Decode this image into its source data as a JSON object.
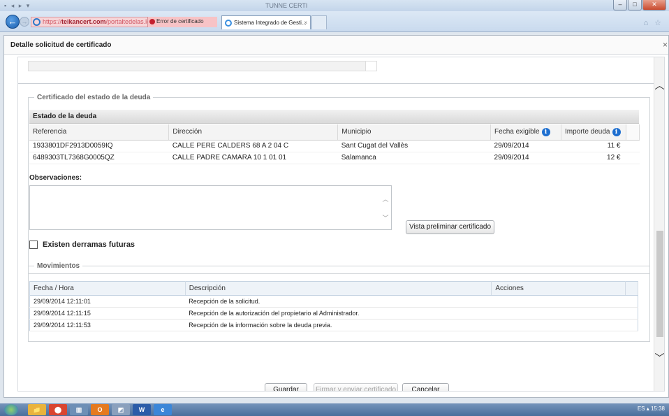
{
  "browser": {
    "title_blurred": "TUNNE CERTI",
    "address": {
      "prefix": "https://",
      "host": "teikancert.com",
      "rest": "/portaltedelas.log",
      "tail": "🔍 ▾"
    },
    "cert_error": "Error de certificado",
    "tab_title": "Sistema Integrado de Gesti...",
    "tab_close": "×"
  },
  "modal": {
    "title": "Detalle solicitud de certificado",
    "close": "×"
  },
  "deuda": {
    "legend": "Certificado del estado de la deuda",
    "bar_title": "Estado de la deuda",
    "columns": [
      "Referencia",
      "Dirección",
      "Municipio",
      "Fecha exigible",
      "Importe deuda"
    ],
    "rows": [
      {
        "referencia": "1933801DF2913D0059IQ",
        "direccion": "CALLE PERE CALDERS 68 A 2 04 C",
        "municipio": "Sant Cugat del Vallès",
        "fecha": "29/09/2014",
        "importe": "11 €"
      },
      {
        "referencia": "6489303TL7368G0005QZ",
        "direccion": "CALLE PADRE CAMARA 10 1 01 01",
        "municipio": "Salamanca",
        "fecha": "29/09/2014",
        "importe": "12 €"
      }
    ]
  },
  "observaciones": {
    "label": "Observaciones:",
    "value": ""
  },
  "preview_button": "Vista preliminar certificado",
  "derramas": {
    "label": "Existen derramas futuras",
    "checked": false
  },
  "movimientos": {
    "legend": "Movimientos",
    "columns": [
      "Fecha / Hora",
      "Descripción",
      "Acciones"
    ],
    "rows": [
      {
        "fecha": "29/09/2014 12:11:01",
        "descripcion": "Recepción de la solicitud."
      },
      {
        "fecha": "29/09/2014 12:11:15",
        "descripcion": "Recepción de la autorización del propietario al Administrador."
      },
      {
        "fecha": "29/09/2014 12:11:53",
        "descripcion": "Recepción de la información sobre la deuda previa."
      }
    ]
  },
  "actions": {
    "guardar": "Guardar",
    "firmar": "Firmar y enviar certificado",
    "cancelar": "Cancelar"
  },
  "taskbar": {
    "apps": [
      "📁",
      "⬤",
      "▥",
      "O",
      "◩",
      "W",
      "e"
    ],
    "tray_text": "ES ▴ 15:38"
  },
  "colors": {
    "accent": "#1e6fd0",
    "error": "#c4202e"
  }
}
